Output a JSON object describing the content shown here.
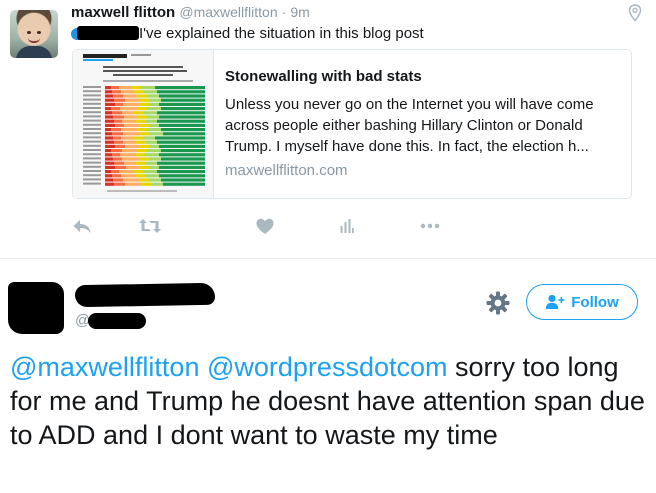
{
  "tweet1": {
    "author_name": "maxwell flitton",
    "author_handle": "@maxwellflitton",
    "time": "· 9m",
    "text": "I've explained the situation in this blog post",
    "card": {
      "title": "Stonewalling with bad stats",
      "description": "Unless you never go on the Internet you will have come across people either bashing Hillary Clinton or Donald Trump. I myself have done this. In fact, the election h...",
      "domain": "maxwellflitton.com"
    },
    "actions": [
      "reply-icon",
      "retweet-icon",
      "like-icon",
      "analytics-icon",
      "more-icon"
    ]
  },
  "tweet2": {
    "handle_prefix": "@",
    "follow_label": "Follow",
    "mention1": "@maxwellflitton",
    "mention2": "@wordpressdotcom",
    "text": " sorry too long for me and Trump he doesnt have attention span due to ADD and I dont want to waste my time"
  },
  "colors": {
    "accent": "#1da1f2",
    "muted": "#8899a6",
    "text": "#14171a",
    "border": "#e1e8ed"
  }
}
